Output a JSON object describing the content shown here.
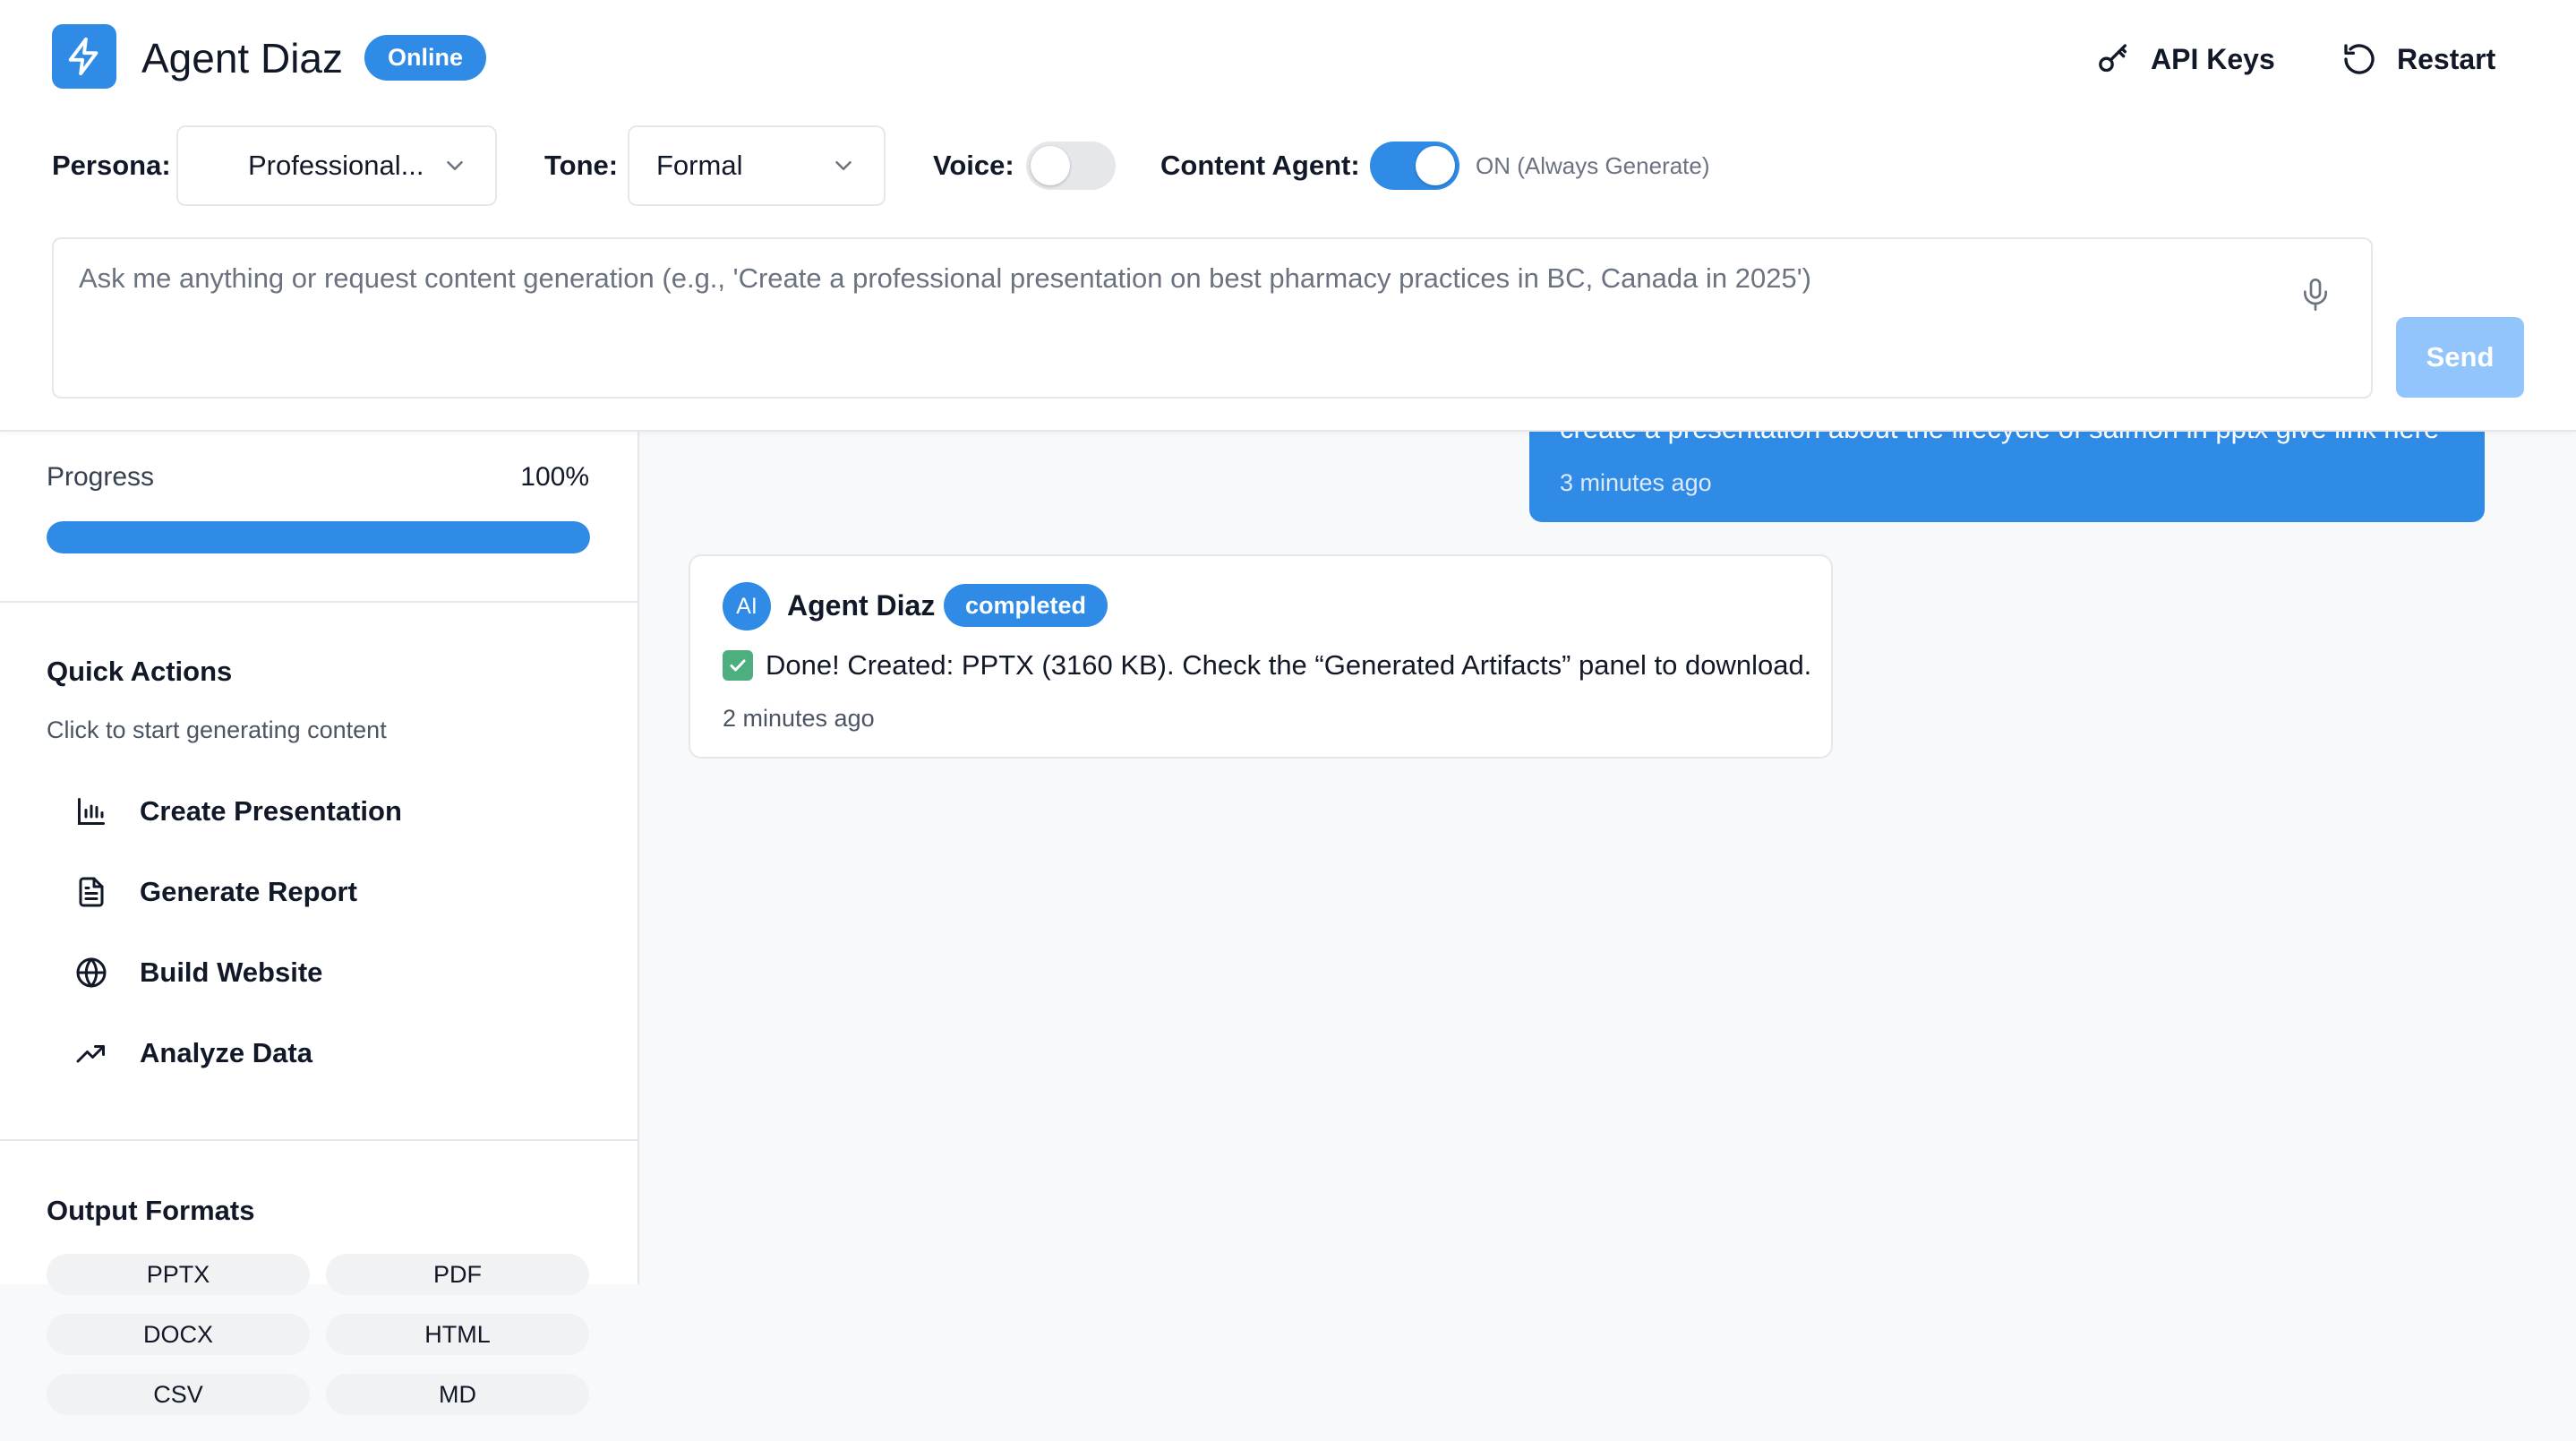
{
  "header": {
    "app_title": "Agent Diaz",
    "status": "Online",
    "logo_icon": "lightning-bolt-icon",
    "api_keys_label": "API Keys",
    "restart_label": "Restart"
  },
  "controls": {
    "persona_label": "Persona:",
    "persona_value": "Professional...",
    "tone_label": "Tone:",
    "tone_value": "Formal",
    "voice_label": "Voice:",
    "voice_on": false,
    "content_agent_label": "Content Agent:",
    "content_agent_on": true,
    "content_agent_status": "ON (Always Generate)"
  },
  "prompt": {
    "placeholder": "Ask me anything or request content generation (e.g., 'Create a professional presentation on best pharmacy practices in BC, Canada in 2025')",
    "value": "",
    "send_label": "Send"
  },
  "sidebar": {
    "progress_label": "Progress",
    "progress_value": "100%",
    "progress_fraction": 1.0,
    "quick_actions_title": "Quick Actions",
    "quick_actions_subtitle": "Click to start generating content",
    "quick_actions": [
      {
        "label": "Create Presentation",
        "icon": "bar-chart-icon"
      },
      {
        "label": "Generate Report",
        "icon": "document-icon"
      },
      {
        "label": "Build Website",
        "icon": "globe-icon"
      },
      {
        "label": "Analyze Data",
        "icon": "trending-up-icon"
      }
    ],
    "output_formats_title": "Output Formats",
    "output_formats": [
      "PPTX",
      "PDF",
      "DOCX",
      "HTML",
      "CSV",
      "MD"
    ]
  },
  "chat": {
    "user_message": {
      "text": "create a presentation about the lifecycle of salmon in pptx give link here",
      "time": "3 minutes ago"
    },
    "ai_message": {
      "avatar": "AI",
      "name": "Agent Diaz",
      "badge": "completed",
      "text": "Done! Created: PPTX (3160 KB). Check the “Generated Artifacts” panel to download.",
      "time": "2 minutes ago"
    }
  },
  "colors": {
    "accent": "#2f8be6",
    "send_disabled": "#93c5fd",
    "success": "#4caf7d"
  }
}
